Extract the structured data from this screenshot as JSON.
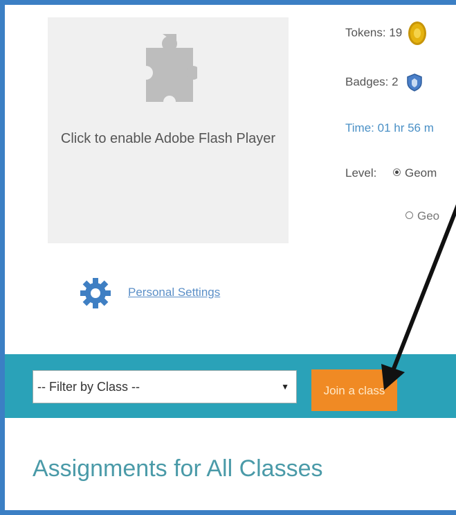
{
  "flash": {
    "message": "Click to enable Adobe Flash Player",
    "icon": "puzzle-piece-icon"
  },
  "stats": {
    "tokens_label": "Tokens:",
    "tokens_value": "19",
    "tokens_icon": "coin-icon",
    "badges_label": "Badges:",
    "badges_value": "2",
    "badges_icon": "shield-badge-icon",
    "time_label": "Time:",
    "time_value": "01 hr 56 m",
    "level_label": "Level:",
    "level_options": [
      "Geom",
      "Geo"
    ],
    "level_selected_index": 0
  },
  "settings": {
    "link_label": "Personal Settings",
    "icon": "gear-icon"
  },
  "class_bar": {
    "filter_value": "-- Filter by Class --",
    "join_label": "Join a class"
  },
  "main": {
    "heading": "Assignments for All Classes"
  },
  "colors": {
    "frame": "#3b7fc4",
    "bar": "#2aa2b8",
    "join_button": "#f08a24",
    "heading": "#4a9aa8",
    "link": "#5b8fc7"
  }
}
